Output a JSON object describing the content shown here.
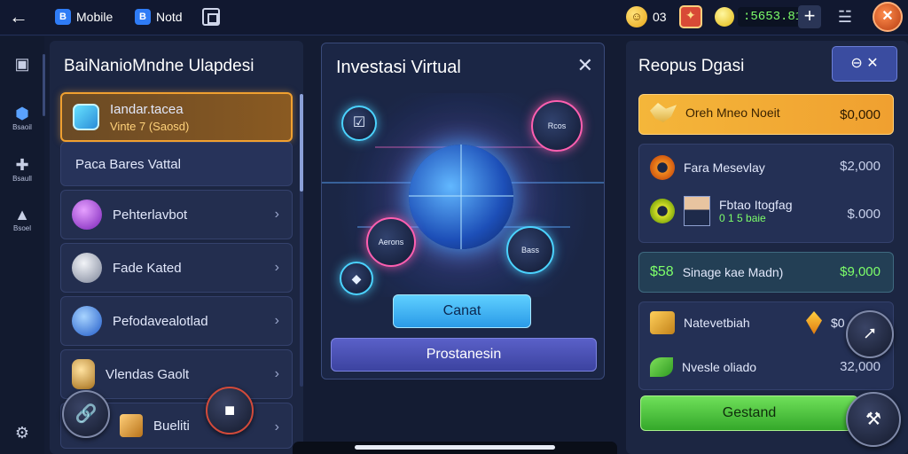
{
  "topbar": {
    "back_icon": "arrow-left-icon",
    "tabs": [
      {
        "label": "Mobile",
        "icon": "app-b-icon",
        "glyph": "B"
      },
      {
        "label": "Notd",
        "icon": "app-b-icon",
        "glyph": "B"
      }
    ],
    "coin_count": "03",
    "balance": ":5653.810",
    "plus": "+",
    "avatar_glyph": "✕"
  },
  "rail": {
    "items": [
      {
        "label": "",
        "icon": "photo-icon",
        "glyph": "▣"
      },
      {
        "label": "Bsaoil",
        "icon": "cube-icon",
        "glyph": "⬢"
      },
      {
        "label": "Bsaull",
        "icon": "controller-icon",
        "glyph": "✚"
      },
      {
        "label": "Bsoel",
        "icon": "warning-icon",
        "glyph": "▲"
      }
    ],
    "settings_icon": "gear-icon",
    "settings_glyph": "⚙"
  },
  "left_panel": {
    "title": "BaiNanioMndne Ulapdesi",
    "items": [
      {
        "label": "Iandar.tacea",
        "sub": "Vinte 7 (Saosd)",
        "selected": true
      },
      {
        "label": "Paca Bares Vattal"
      },
      {
        "label": "Pehterlavbot",
        "orb_color": "#b04ce0"
      },
      {
        "label": "Fade Kated",
        "orb_color": "#9aa3b8"
      },
      {
        "label": "Pefodavealotlad",
        "orb_color": "#3c7de0"
      },
      {
        "label": "Vlendas Gaolt",
        "orb_color": "#d8a04a"
      },
      {
        "label": "Bueliti"
      }
    ],
    "chevron": "›"
  },
  "dialog": {
    "title": "Investasi Virtual",
    "close": "✕",
    "nodes": {
      "top_right": "Rcos",
      "left": "Aerons",
      "right": "Bass"
    },
    "primary_button": "Canat",
    "secondary_button": "Prostanesin"
  },
  "right_panel": {
    "title": "Reopus Dgasi",
    "header_button": "⊖ ✕",
    "rows": [
      {
        "label": "Oreh Mneo Noeit",
        "value": "$0,000",
        "highlight": true
      },
      {
        "label": "Fara Mesevlay",
        "value": "$2,000"
      },
      {
        "label": "Fbtao Itogfag",
        "sub": "0 1 5 baie",
        "value": "$.000"
      },
      {
        "label": "Sinage kae Madn)",
        "prefix": "$58",
        "value": "$9,000",
        "green": true
      },
      {
        "label": "Natevetbiah",
        "value": "$0"
      },
      {
        "label": "Nvesle oliado",
        "value": "32,000"
      }
    ],
    "cta": "Gestand"
  },
  "colors": {
    "accent": "#f0a030",
    "highlight_row": "#f0a030",
    "cta": "#4cc43a",
    "primary": "#3fb0f4"
  }
}
